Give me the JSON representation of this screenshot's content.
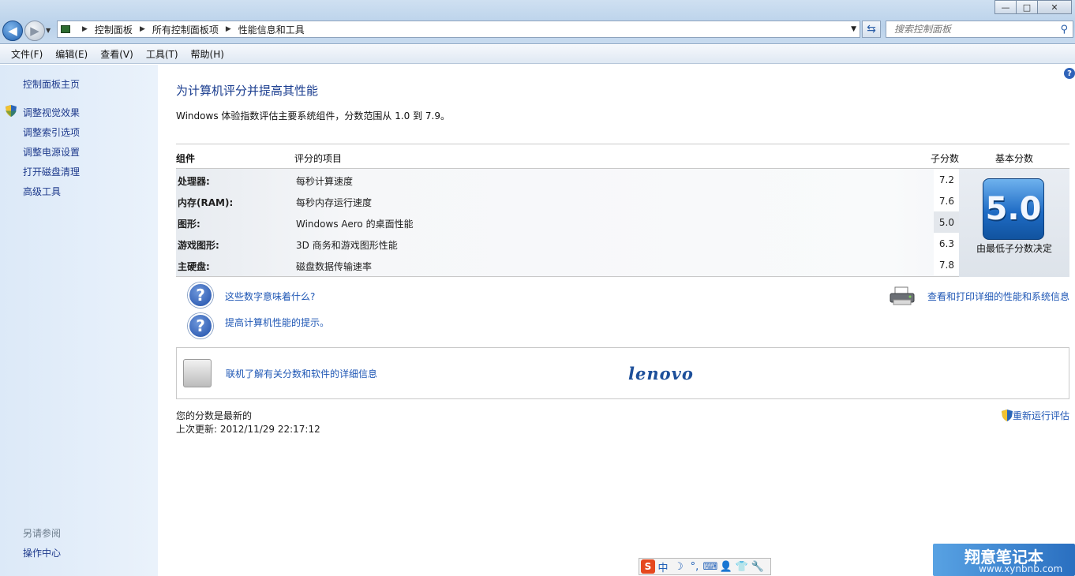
{
  "window": {
    "buttons": {
      "minimize": "—",
      "maximize": "□",
      "close": "✕"
    }
  },
  "address": {
    "crumbs": [
      "控制面板",
      "所有控制面板项",
      "性能信息和工具"
    ]
  },
  "search": {
    "placeholder": "搜索控制面板"
  },
  "menu": [
    "文件(F)",
    "编辑(E)",
    "查看(V)",
    "工具(T)",
    "帮助(H)"
  ],
  "sidebar": {
    "home": "控制面板主页",
    "items": [
      "调整视觉效果",
      "调整索引选项",
      "调整电源设置",
      "打开磁盘清理",
      "高级工具"
    ],
    "see_also_label": "另请参阅",
    "see_also": [
      "操作中心"
    ]
  },
  "main": {
    "title": "为计算机评分并提高其性能",
    "description": "Windows 体验指数评估主要系统组件，分数范围从 1.0 到 7.9。",
    "table": {
      "headers": {
        "component": "组件",
        "rated": "评分的项目",
        "subscore": "子分数",
        "basescore": "基本分数"
      },
      "rows": [
        {
          "component": "处理器:",
          "rated": "每秒计算速度",
          "subscore": "7.2"
        },
        {
          "component": "内存(RAM):",
          "rated": "每秒内存运行速度",
          "subscore": "7.6"
        },
        {
          "component": "图形:",
          "rated": "Windows Aero 的桌面性能",
          "subscore": "5.0"
        },
        {
          "component": "游戏图形:",
          "rated": "3D 商务和游戏图形性能",
          "subscore": "6.3"
        },
        {
          "component": "主硬盘:",
          "rated": "磁盘数据传输速率",
          "subscore": "7.8"
        }
      ],
      "base_score": "5.0",
      "base_caption": "由最低子分数决定"
    },
    "links": {
      "what_numbers": "这些数字意味着什么?",
      "tips": "提高计算机性能的提示。",
      "print": "查看和打印详细的性能和系统信息"
    },
    "lenovo": {
      "link": "联机了解有关分数和软件的详细信息",
      "logo": "lenovo"
    },
    "status": {
      "current": "您的分数是最新的",
      "last_update": "上次更新: 2012/11/29 22:17:12",
      "rerun": "重新运行评估"
    }
  },
  "ime": {
    "items": [
      "S",
      "中",
      "☽",
      "°,",
      "⌨",
      "👤",
      "👕",
      "🔧"
    ]
  },
  "watermark": {
    "title": "翔意笔记本",
    "url": "www.xynbnb.com"
  },
  "colors": {
    "link": "#1f57b5",
    "title": "#1a3d8f",
    "sidebar_bg": "#dce9f8",
    "badge": "#1f6cc5"
  }
}
